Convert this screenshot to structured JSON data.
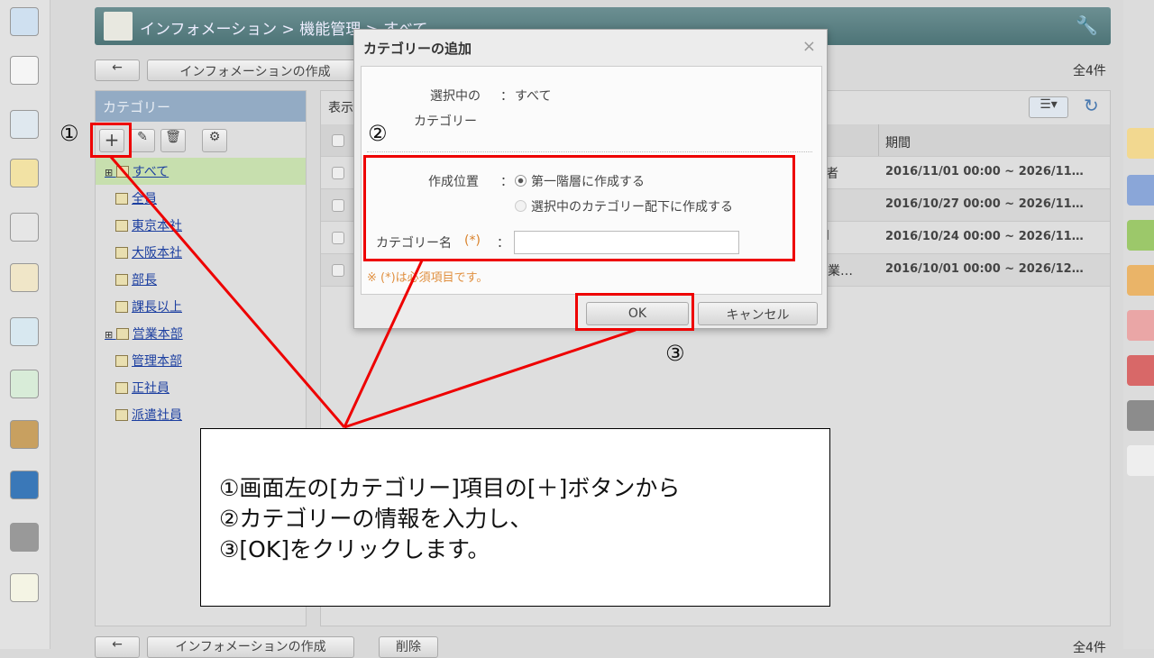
{
  "header": {
    "breadcrumb": "インフォメーション > 機能管理 > すべて"
  },
  "toolbar": {
    "back_label": "←",
    "create_label": "インフォメーションの作成",
    "delete_label": "削除",
    "count": "全4件"
  },
  "category": {
    "title": "カテゴリー",
    "items": [
      "すべて",
      "全員",
      "東京本社",
      "大阪本社",
      "部長",
      "課長以上",
      "営業本部",
      "管理本部",
      "正社員",
      "派遣社員"
    ]
  },
  "list": {
    "display_label": "表示",
    "period_header": "期間",
    "rows": [
      {
        "frag": "者",
        "period": "2016/11/01 00:00 ~ 2026/11…"
      },
      {
        "frag": "",
        "period": "2016/10/27 00:00 ~ 2026/11…"
      },
      {
        "frag": "l",
        "period": "2016/10/24 00:00 ~ 2026/11…"
      },
      {
        "frag": "営業…",
        "period": "2016/10/01 00:00 ~ 2026/12…"
      }
    ]
  },
  "dialog": {
    "title": "カテゴリーの追加",
    "close": "×",
    "selected_label1": "選択中の",
    "selected_label2": "カテゴリー",
    "colon": "：",
    "selected_value": "すべて",
    "position_label": "作成位置",
    "option1": "第一階層に作成する",
    "option2": "選択中のカテゴリー配下に作成する",
    "name_label": "カテゴリー名",
    "required_mark": "(*)",
    "name_value": "",
    "note": "※ (*)は必須項目です。",
    "ok": "OK",
    "cancel": "キャンセル"
  },
  "annotations": {
    "n1": "①",
    "n2": "②",
    "n3": "③",
    "lines": [
      "①画面左の[カテゴリー]項目の[＋]ボタンから",
      "②カテゴリーの情報を入力し、",
      "③[OK]をクリックします。"
    ]
  },
  "colors": {
    "annotation": "#e00000",
    "header": "#5a7f82",
    "category_header": "#93abc4"
  }
}
